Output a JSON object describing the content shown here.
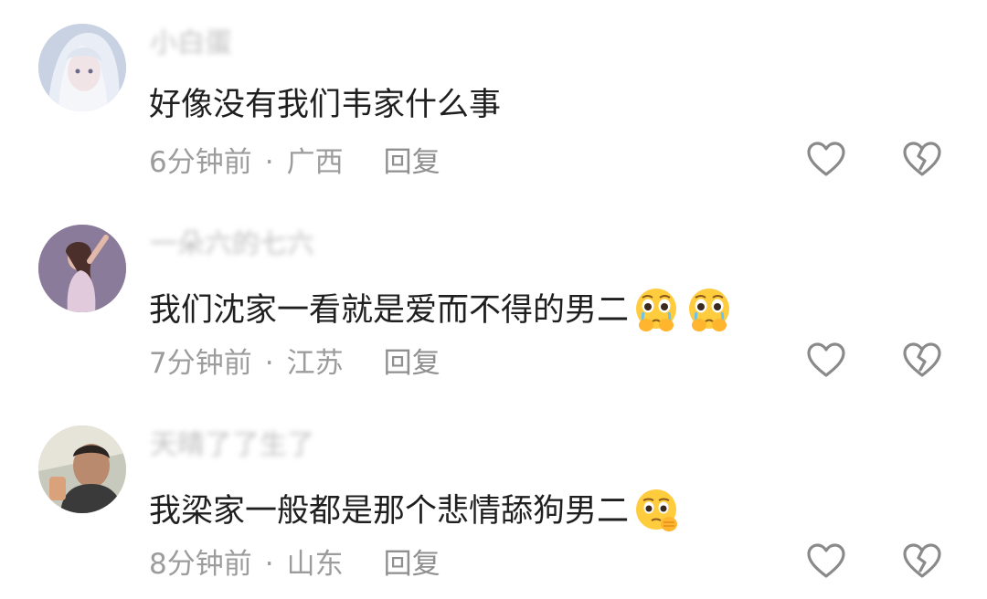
{
  "comments": [
    {
      "username": "小白蛋",
      "text": "好像没有我们韦家什么事",
      "emojis": [],
      "time": "6分钟前",
      "separator": "·",
      "location": "广西",
      "reply_label": "回复",
      "avatar": "avatar-white-hair-anime"
    },
    {
      "username": "一朵六的七六",
      "text": "我们沈家一看就是爱而不得的男二",
      "emojis": [
        "crying-emoji",
        "crying-emoji"
      ],
      "time": "7分钟前",
      "separator": "·",
      "location": "江苏",
      "reply_label": "回复",
      "avatar": "avatar-dancer-purple"
    },
    {
      "username": "天晴了了生了",
      "text": "我梁家一般都是那个悲情舔狗男二",
      "emojis": [
        "pleading-emoji"
      ],
      "time": "8分钟前",
      "separator": "·",
      "location": "山东",
      "reply_label": "回复",
      "avatar": "avatar-man-photo"
    }
  ],
  "icons": {
    "like": "heart-outline-icon",
    "dislike": "broken-heart-icon"
  },
  "colors": {
    "text": "#1f1f1f",
    "meta": "#9c9c9c",
    "icon": "#8a8a8a"
  }
}
